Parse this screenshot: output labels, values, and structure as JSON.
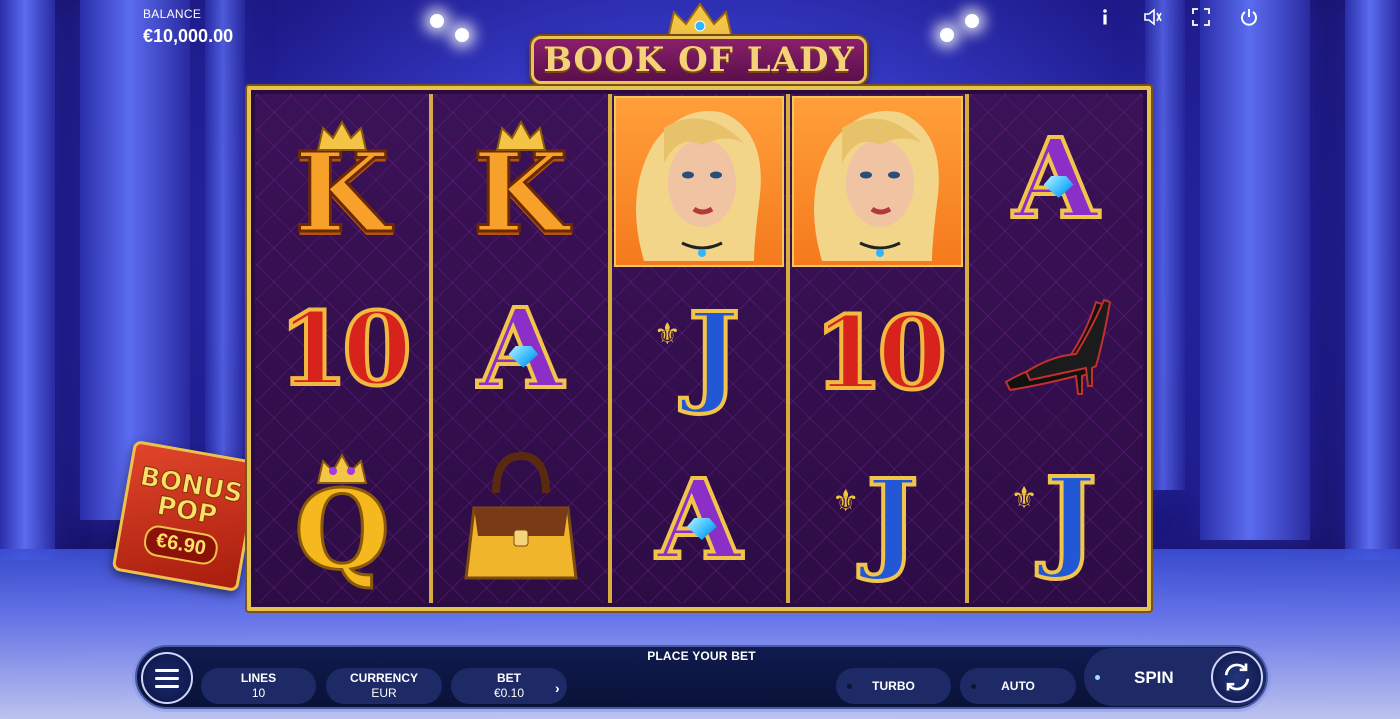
{
  "game": {
    "title": "BOOK OF LADY"
  },
  "hud": {
    "balance_label": "BALANCE",
    "balance_value": "€10,000.00",
    "icons": [
      "info-icon",
      "sound-icon",
      "fullscreen-icon",
      "power-icon"
    ]
  },
  "reels": [
    [
      "K",
      "10",
      "Q"
    ],
    [
      "K",
      "A",
      "handbag"
    ],
    [
      "lady",
      "J",
      "A"
    ],
    [
      "lady",
      "10",
      "J"
    ],
    [
      "A",
      "heels",
      "J"
    ]
  ],
  "bonus": {
    "line1": "BONUS",
    "line2": "POP",
    "amount": "€6.90"
  },
  "controls": {
    "status": "PLACE YOUR BET",
    "lines_label": "LINES",
    "lines_value": "10",
    "currency_label": "CURRENCY",
    "currency_value": "EUR",
    "bet_label": "BET",
    "bet_value": "€0.10",
    "bet_arrow": "›",
    "turbo_label": "TURBO",
    "auto_label": "AUTO",
    "spin_label": "SPIN"
  },
  "colors": {
    "frame_gold": "#e6c24e",
    "reel_purple": "#3b1257",
    "bar_navy": "#0f1b4e",
    "lady_bg": "#f57a1d"
  }
}
